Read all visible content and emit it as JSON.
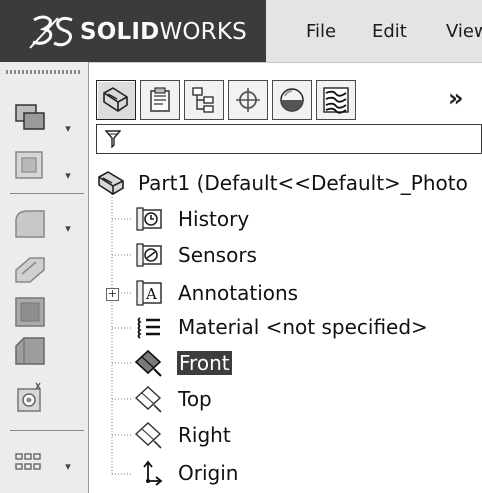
{
  "app": {
    "brand_prefix": "SOLID",
    "brand_suffix": "WORKS",
    "menu": [
      "File",
      "Edit",
      "View"
    ]
  },
  "left_toolbar": {
    "tools": [
      "extruded-boss-icon",
      "extruded-cut-icon",
      "fillet-icon",
      "chamfer-icon",
      "shell-icon",
      "rib-icon",
      "hole-wizard-icon",
      "linear-pattern-icon"
    ]
  },
  "feature_manager": {
    "tabs": [
      "feature-manager-tab",
      "property-manager-tab",
      "configuration-manager-tab",
      "dimxpert-manager-tab",
      "display-manager-tab",
      "cam-tab"
    ],
    "more_glyph": "»",
    "filter_icon": "filter-icon",
    "tree": [
      {
        "label": "Part1  (Default<<Default>_Photo",
        "icon": "part-icon"
      },
      {
        "label": "History",
        "icon": "history-icon"
      },
      {
        "label": "Sensors",
        "icon": "sensors-icon"
      },
      {
        "label": "Annotations",
        "icon": "annotations-icon",
        "expandable": true
      },
      {
        "label": "Material <not specified>",
        "icon": "material-icon"
      },
      {
        "label": "Front",
        "icon": "plane-icon",
        "selected": true
      },
      {
        "label": "Top",
        "icon": "plane-icon"
      },
      {
        "label": "Right",
        "icon": "plane-icon"
      },
      {
        "label": "Origin",
        "icon": "origin-icon"
      }
    ]
  }
}
